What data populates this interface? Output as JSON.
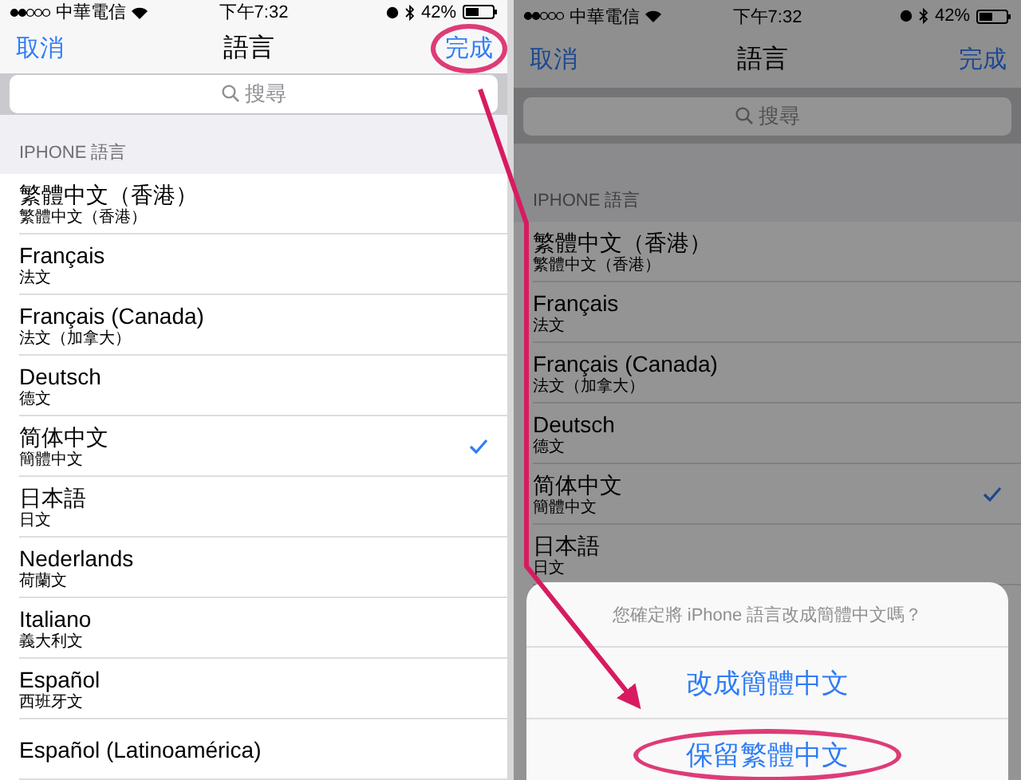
{
  "screens": [
    {
      "dimmed": false,
      "status_bar": {
        "carrier": "中華電信",
        "time": "下午7:32",
        "battery": "42%"
      },
      "nav": {
        "cancel": "取消",
        "title": "語言",
        "done": "完成",
        "done_circled": true
      },
      "search": {
        "placeholder": "搜尋"
      },
      "section_header": "IPHONE 語言",
      "languages": [
        {
          "name": "繁體中文（香港）",
          "native": "繁體中文（香港）",
          "selected": false
        },
        {
          "name": "Français",
          "native": "法文",
          "selected": false
        },
        {
          "name": "Français (Canada)",
          "native": "法文（加拿大）",
          "selected": false
        },
        {
          "name": "Deutsch",
          "native": "德文",
          "selected": false
        },
        {
          "name": "简体中文",
          "native": "簡體中文",
          "selected": true
        },
        {
          "name": "日本語",
          "native": "日文",
          "selected": false
        },
        {
          "name": "Nederlands",
          "native": "荷蘭文",
          "selected": false
        },
        {
          "name": "Italiano",
          "native": "義大利文",
          "selected": false
        },
        {
          "name": "Español",
          "native": "西班牙文",
          "selected": false
        },
        {
          "name": "Español (Latinoamérica)",
          "selected": false
        }
      ]
    },
    {
      "dimmed": true,
      "status_bar": {
        "carrier": "中華電信",
        "time": "下午7:32",
        "battery": "42%"
      },
      "nav": {
        "cancel": "取消",
        "title": "語言",
        "done": "完成",
        "done_circled": false
      },
      "search": {
        "placeholder": "搜尋"
      },
      "section_header": "IPHONE 語言",
      "languages": [
        {
          "name": "繁體中文（香港）",
          "native": "繁體中文（香港）",
          "selected": false
        },
        {
          "name": "Français",
          "native": "法文",
          "selected": false
        },
        {
          "name": "Français (Canada)",
          "native": "法文（加拿大）",
          "selected": false
        },
        {
          "name": "Deutsch",
          "native": "德文",
          "selected": false
        },
        {
          "name": "简体中文",
          "native": "簡體中文",
          "selected": true
        },
        {
          "name": "日本語",
          "native": "日文",
          "selected": false
        }
      ],
      "action_sheet": {
        "message": "您確定將 iPhone 語言改成簡體中文嗎？",
        "actions": [
          {
            "label": "改成簡體中文",
            "circled": false
          },
          {
            "label": "保留繁體中文",
            "circled": true
          }
        ]
      }
    }
  ]
}
